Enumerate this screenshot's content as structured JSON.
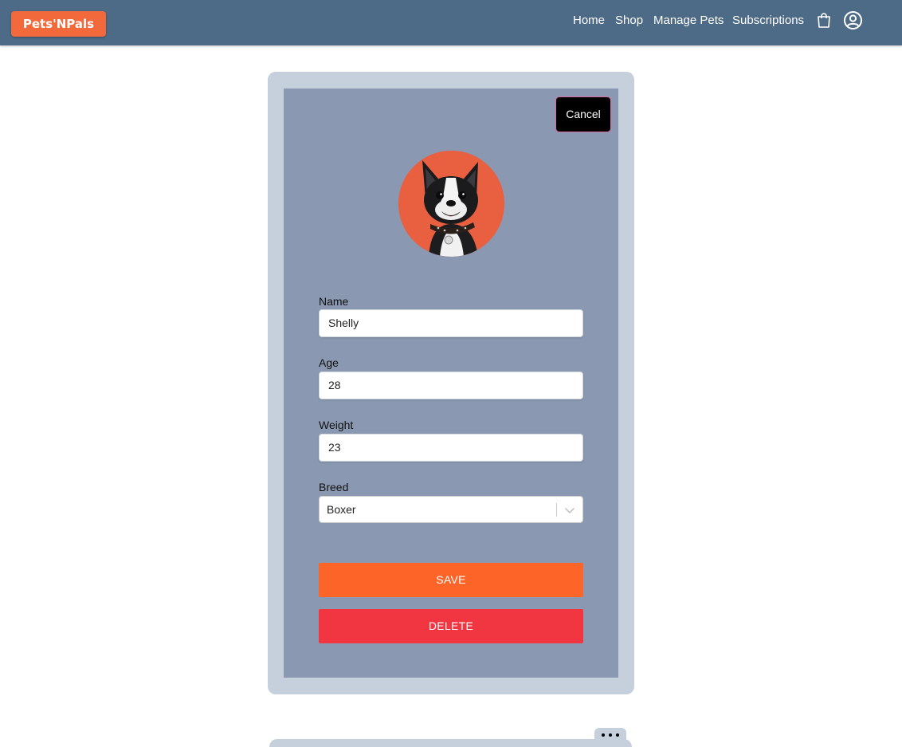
{
  "brand": {
    "logo_text": "Pets'NPals"
  },
  "nav": {
    "links": [
      "Home",
      "Shop",
      "Manage Pets",
      "Subscriptions"
    ],
    "icons": [
      "shopping-bag-icon",
      "user-account-icon"
    ]
  },
  "pet_form": {
    "cancel_label": "Cancel",
    "photo_icon": "pet-photo",
    "fields": {
      "name": {
        "label": "Name",
        "value": "Shelly"
      },
      "age": {
        "label": "Age",
        "value": "28"
      },
      "weight": {
        "label": "Weight",
        "value": "23"
      },
      "breed": {
        "label": "Breed",
        "value": "Boxer"
      }
    },
    "save_label": "SAVE",
    "delete_label": "DELETE"
  },
  "colors": {
    "navbar": "#4d6a86",
    "brand": "#f26a3c",
    "card_outer": "#c5d0dc",
    "card_inner": "#8a99b1",
    "save": "#fc6428",
    "delete": "#f13642"
  }
}
